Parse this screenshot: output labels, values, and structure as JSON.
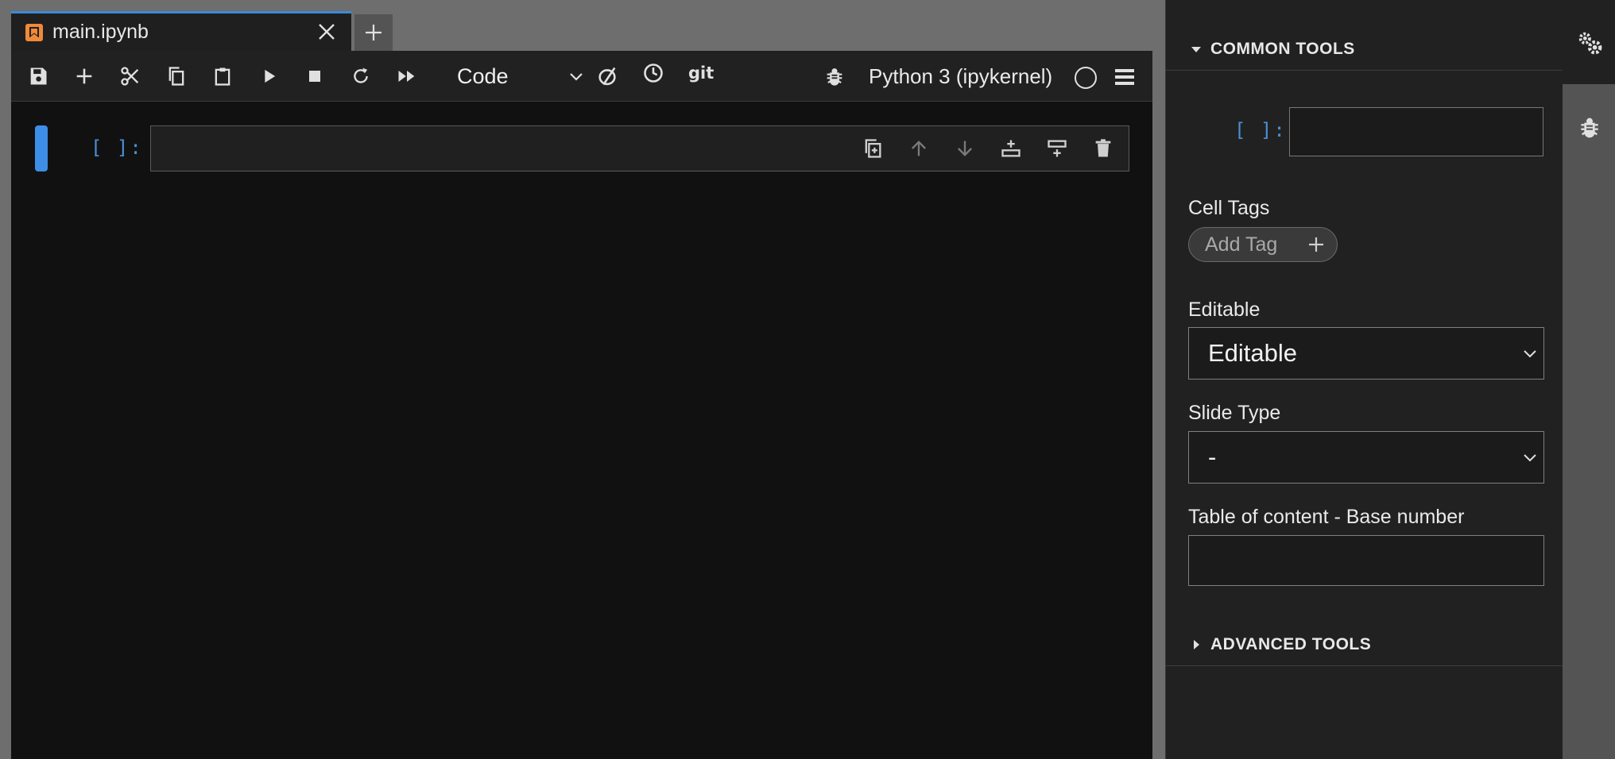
{
  "tab": {
    "title": "main.ipynb",
    "icon": "notebook-icon"
  },
  "toolbar": {
    "cell_type": "Code",
    "git_label": "git",
    "kernel_name": "Python 3 (ipykernel)",
    "icons": [
      "save-icon",
      "add-cell-icon",
      "cut-icon",
      "copy-icon",
      "paste-icon",
      "run-icon",
      "stop-icon",
      "restart-icon",
      "run-all-icon",
      "kernel-status-icon",
      "history-icon",
      "git-icon",
      "debugger-icon",
      "kernel-idle-icon",
      "menu-icon"
    ]
  },
  "notebook": {
    "cell": {
      "prompt": "[ ]:",
      "content": ""
    }
  },
  "inspector": {
    "common_tools_header": "COMMON TOOLS",
    "prompt": "[ ]:",
    "cell_tags_label": "Cell Tags",
    "add_tag_label": "Add Tag",
    "editable_label": "Editable",
    "editable_value": "Editable",
    "slide_type_label": "Slide Type",
    "slide_type_value": "-",
    "toc_label": "Table of content - Base number",
    "toc_value": "",
    "advanced_tools_header": "ADVANCED TOOLS"
  },
  "colors": {
    "accent": "#3b8ad8",
    "prompt": "#4b8fd7",
    "notebook_icon": "#f08a3a",
    "background": "#111111",
    "panel": "#212121"
  }
}
